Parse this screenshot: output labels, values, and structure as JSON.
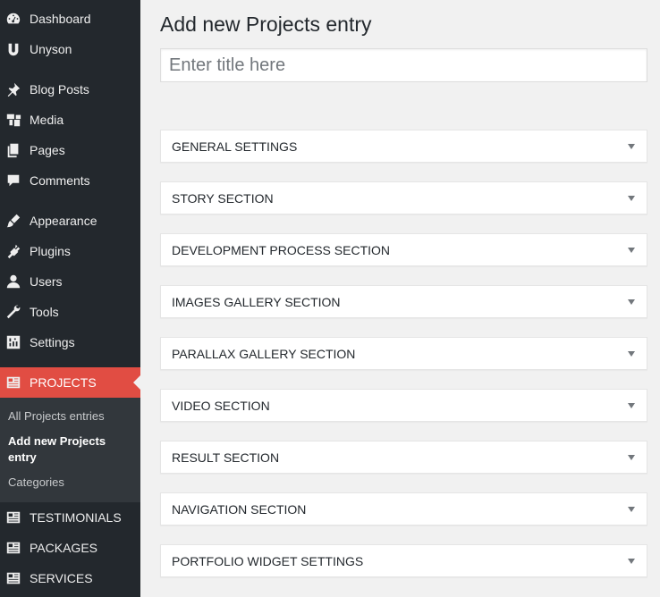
{
  "sidebar": {
    "items": [
      {
        "label": "Dashboard",
        "icon": "dashboard-icon"
      },
      {
        "label": "Unyson",
        "icon": "unyson-icon"
      },
      {
        "label": "Blog Posts",
        "icon": "pin-icon"
      },
      {
        "label": "Media",
        "icon": "media-icon"
      },
      {
        "label": "Pages",
        "icon": "pages-icon"
      },
      {
        "label": "Comments",
        "icon": "comments-icon"
      },
      {
        "label": "Appearance",
        "icon": "appearance-icon"
      },
      {
        "label": "Plugins",
        "icon": "plugins-icon"
      },
      {
        "label": "Users",
        "icon": "users-icon"
      },
      {
        "label": "Tools",
        "icon": "tools-icon"
      },
      {
        "label": "Settings",
        "icon": "settings-icon"
      },
      {
        "label": "PROJECTS",
        "icon": "projects-icon"
      },
      {
        "label": "TESTIMONIALS",
        "icon": "testimonials-icon"
      },
      {
        "label": "PACKAGES",
        "icon": "packages-icon"
      },
      {
        "label": "SERVICES",
        "icon": "services-icon"
      }
    ],
    "submenu": [
      {
        "label": "All Projects entries"
      },
      {
        "label": "Add new Projects entry"
      },
      {
        "label": "Categories"
      }
    ],
    "active_color": "#e14d43",
    "background_color": "#23282d"
  },
  "main": {
    "title": "Add new Projects entry",
    "title_input": {
      "value": "",
      "placeholder": "Enter title here"
    },
    "sections": [
      {
        "label": "GENERAL SETTINGS"
      },
      {
        "label": "STORY SECTION"
      },
      {
        "label": "DEVELOPMENT PROCESS SECTION"
      },
      {
        "label": "IMAGES GALLERY SECTION"
      },
      {
        "label": "PARALLAX GALLERY SECTION"
      },
      {
        "label": "VIDEO SECTION"
      },
      {
        "label": "RESULT SECTION"
      },
      {
        "label": "NAVIGATION SECTION"
      },
      {
        "label": "PORTFOLIO WIDGET SETTINGS"
      }
    ]
  }
}
